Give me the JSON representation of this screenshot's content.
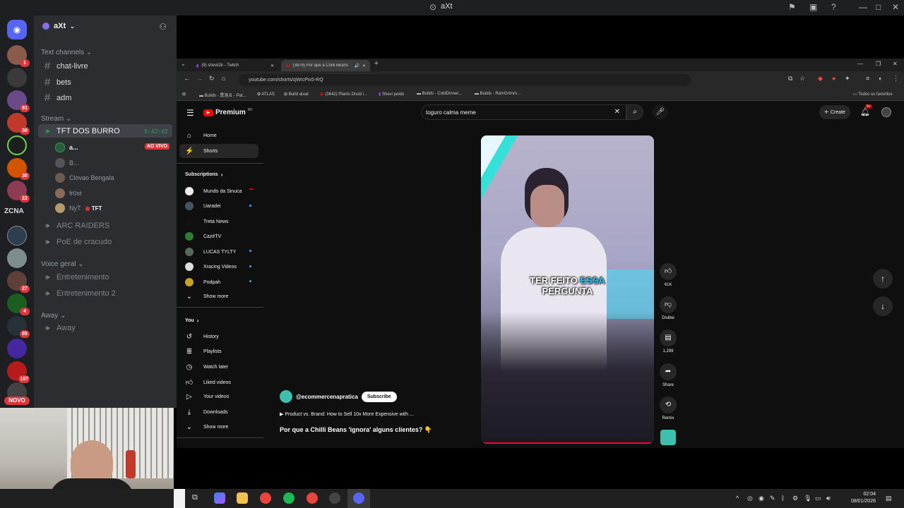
{
  "window": {
    "title": "aXt"
  },
  "discord": {
    "server_name": "aXt",
    "rail_badges": [
      "1",
      "",
      "91",
      "30",
      "",
      "30",
      "22",
      "",
      "",
      "27",
      "4",
      "85",
      "",
      "157"
    ],
    "rail_text_label": "ZCNA",
    "novo_label": "NOVO",
    "categories": {
      "text": "Text channels",
      "stream": "Stream",
      "voice": "Voice geral",
      "away": "Away"
    },
    "text_channels": [
      "chat-livre",
      "bets",
      "adm"
    ],
    "stream_channel": {
      "name": "TFT DOS BURRO",
      "timer": "5:42:02"
    },
    "voice_users": [
      {
        "name": "a...",
        "badge": "AO VIVO"
      },
      {
        "name": "B..."
      },
      {
        "name": "Clovao Bengala"
      },
      {
        "name": "fr0st"
      },
      {
        "name": "NyT",
        "tag": "TFT"
      }
    ],
    "other_voice": [
      "ARC RAIDERS",
      "PoE de cracudo"
    ],
    "voice_channels": [
      "Entretenimento",
      "Entretenimento 2"
    ],
    "away_channels": [
      "Away"
    ]
  },
  "browser": {
    "tabs": [
      "(9) shevii2k - Twitch",
      "(3878) Por que a Chilli Beans"
    ],
    "url": "youtube.com/shorts/qWrcPix5-RQ",
    "bookmarks": [
      "Builds - 異洛五 - Pat...",
      "ATLAS",
      "Build atual",
      "(3642) Plants Druid i...",
      "Shevi peido",
      "Builds - ColdDinner...",
      "Builds - RamGrimm..."
    ],
    "all_bookmarks": "Todos os favoritos"
  },
  "youtube": {
    "logo": "Premium",
    "logo_sup": "BR",
    "search_value": "toguro calma meme",
    "create_label": "Create",
    "notif_count": "9+",
    "nav": {
      "home": "Home",
      "shorts": "Shorts"
    },
    "subscriptions_label": "Subscriptions",
    "subscriptions": [
      "Mundo da Sinuca",
      "Uaradei",
      "Treta News",
      "CazéTV",
      "LUCAS TYLTY",
      "Xracing Videos",
      "Podpah"
    ],
    "show_more": "Show more",
    "you_label": "You",
    "you_items": [
      "History",
      "Playlists",
      "Watch later",
      "Liked videos",
      "Your videos",
      "Downloads"
    ],
    "short": {
      "caption_line1a": "TER FEITO ",
      "caption_highlight": "ESSA",
      "caption_line2": "PERGUNTA",
      "channel": "@ecommercenapratica",
      "subscribe": "Subscribe",
      "linked_video": "▶ Product vs. Brand: How to Sell 10x More Expensive with ...",
      "title": "Por que a Chilli Beans 'ignora' alguns clientes? 👇",
      "likes": "41K",
      "dislike": "Dislike",
      "comments": "1,299",
      "share": "Share",
      "remix": "Remix"
    }
  },
  "taskbar": {
    "time": "02:04",
    "date": "08/01/2026"
  },
  "colors": {
    "discord_bg": "#2b2d31",
    "rail_bg": "#1e1f22",
    "yt_bg": "#0f0f0f",
    "live_red": "#da373c",
    "highlight_blue": "#2fc4f0"
  }
}
